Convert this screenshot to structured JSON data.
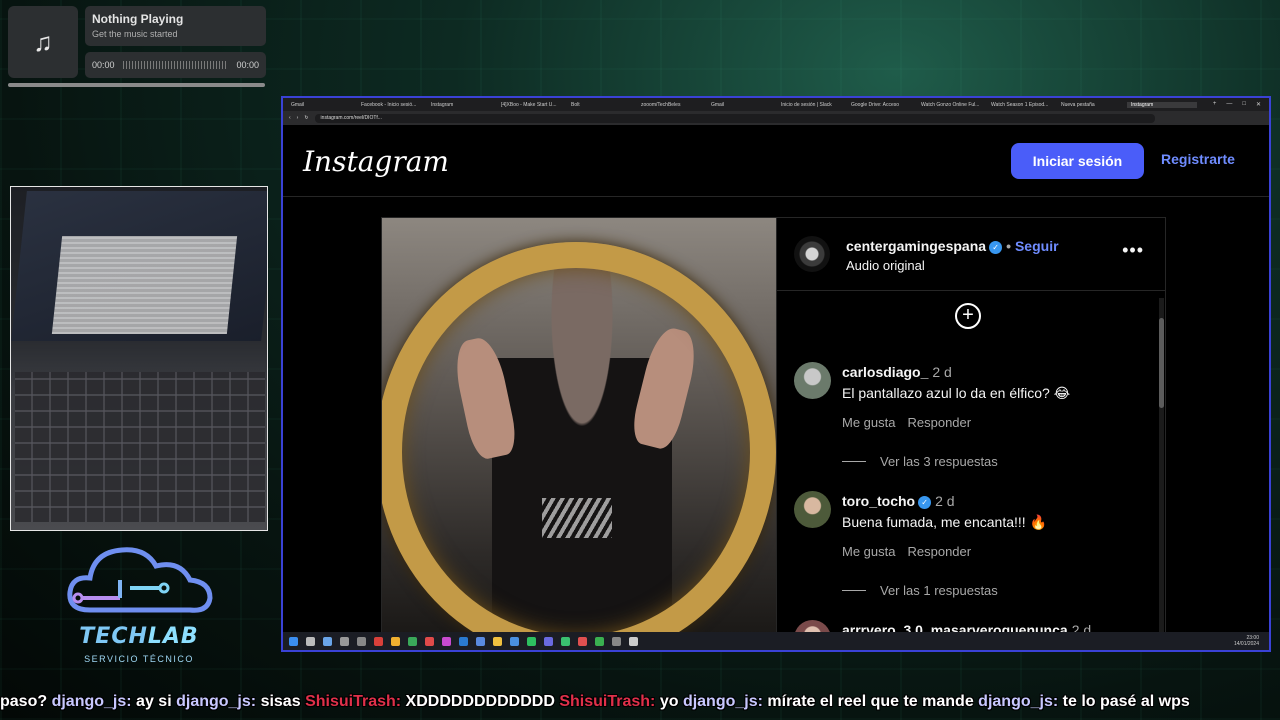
{
  "now_playing": {
    "title": "Nothing Playing",
    "subtitle": "Get the music started",
    "time_current": "00:00",
    "time_total": "00:00",
    "icon": "music-note-icon",
    "progress": 0
  },
  "logo": {
    "name_part1": "TECH",
    "name_part2": "LAB",
    "tagline": "SERVICIO TÉCNICO"
  },
  "browser": {
    "url": "instagram.com/reel/DIOTf...",
    "tabs": [
      "Gmail",
      "Facebook - Inicio sesió...",
      "Instagram",
      "[4]XBoo - Make Start U...",
      "Bolt",
      "zooom/TechBeles",
      "Gmail",
      "Inicio de sesión | Slack",
      "Google Drive: Acceso",
      "Watch Gonzo Online Ful...",
      "Watch Season 1 Episod...",
      "Nueva pestaña",
      "Instagram"
    ],
    "active_tab": "Instagram",
    "tray_time": "23:00",
    "tray_date": "14/01/2024"
  },
  "instagram": {
    "logo": "Instagram",
    "login_label": "Iniciar sesión",
    "register_label": "Registrarte",
    "post": {
      "account": "centergamingespana",
      "follow_label": "Seguir",
      "audio": "Audio original",
      "comments": [
        {
          "user": "carlosdiago_",
          "time": "2 d",
          "text": "El pantallazo azul lo da en élfico? 😂",
          "like_label": "Me gusta",
          "reply_label": "Responder",
          "replies_label": "Ver las 3 respuestas",
          "verified": false
        },
        {
          "user": "toro_tocho",
          "time": "2 d",
          "text": "Buena fumada, me encanta!!! 🔥",
          "like_label": "Me gusta",
          "reply_label": "Responder",
          "replies_label": "Ver las 1 respuestas",
          "verified": true
        },
        {
          "user": "arrrvero_3.0_masarveroquenunca",
          "time": "2 d",
          "text": "",
          "verified": false
        }
      ]
    }
  },
  "chat": [
    {
      "user": "",
      "msg": "paso?"
    },
    {
      "user": "django_js:",
      "msg": "ay si"
    },
    {
      "user": "django_js:",
      "msg": "sisas"
    },
    {
      "user": "ShisuiTrash:",
      "msg": "XDDDDDDDDDDDD",
      "red": true
    },
    {
      "user": "ShisuiTrash:",
      "msg": "yo",
      "red": true
    },
    {
      "user": "django_js:",
      "msg": "mírate el reel que te mande"
    },
    {
      "user": "django_js:",
      "msg": "te lo pasé al wps"
    }
  ]
}
